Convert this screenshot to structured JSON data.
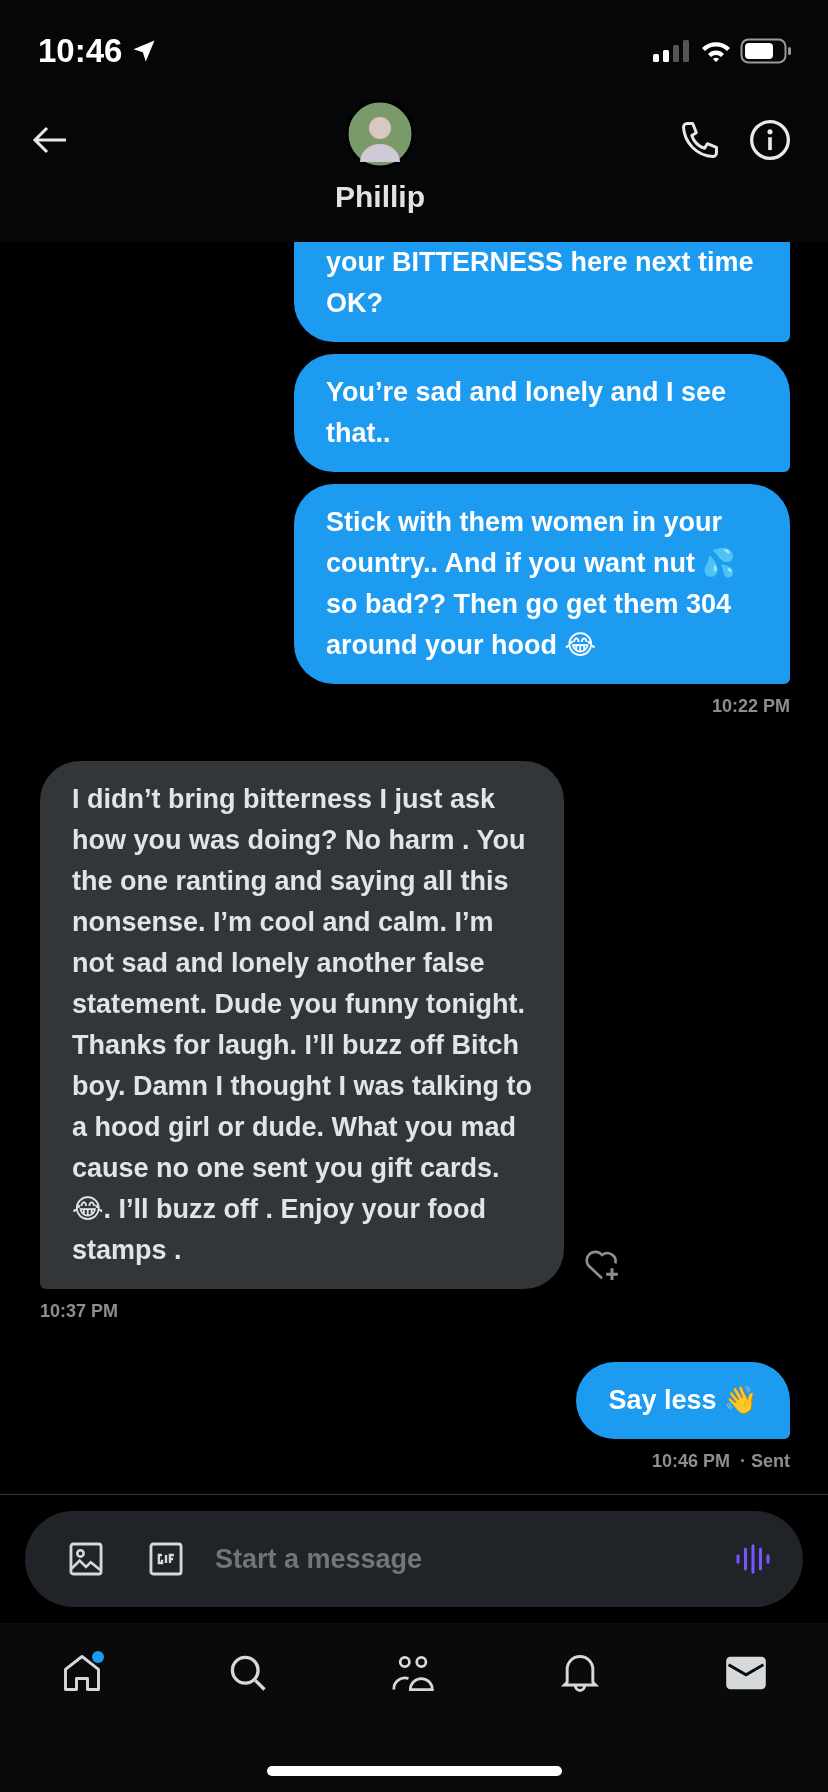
{
  "status_bar": {
    "time": "10:46"
  },
  "header": {
    "name": "Phillip"
  },
  "messages": [
    {
      "kind": "sent",
      "text": "your BITTERNESS here next time OK?",
      "cut_top": true
    },
    {
      "kind": "sent",
      "text": "You’re sad and lonely and I see that.."
    },
    {
      "kind": "sent",
      "text": "Stick with them women in your country.. And if you want nut 💦 so bad?? Then go get them 304 around your hood 😂",
      "time": "10:22 PM"
    },
    {
      "kind": "received",
      "text": "I didn’t bring bitterness I just ask how you was doing? No harm . You the one ranting and saying all this nonsense. I’m cool and calm. I’m not sad and lonely another false statement. Dude you funny tonight.  Thanks for laugh. I’ll buzz off Bitch boy. Damn I thought I was talking to a hood girl or dude. What you mad cause no one sent you gift cards. 😂. I’ll buzz off . Enjoy your food stamps .",
      "time": "10:37 PM"
    },
    {
      "kind": "sent",
      "text": "Say less 👋",
      "time": "10:46 PM",
      "status": "· Sent"
    }
  ],
  "composer": {
    "placeholder": "Start a message"
  },
  "tab_bar": [
    {
      "kind": "home",
      "selected": false,
      "badge": true
    },
    {
      "kind": "search",
      "selected": false,
      "badge": false
    },
    {
      "kind": "people",
      "selected": false,
      "badge": false
    },
    {
      "kind": "bell",
      "selected": false,
      "badge": false
    },
    {
      "kind": "mail",
      "selected": true,
      "badge": false
    }
  ]
}
